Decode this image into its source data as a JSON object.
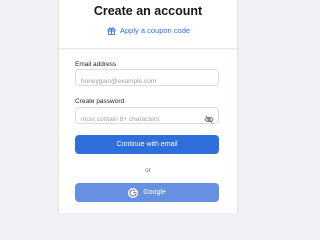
{
  "header": {
    "title": "Create an account",
    "coupon_label": "Apply a coupon code"
  },
  "form": {
    "email": {
      "label": "Email address",
      "value": "",
      "placeholder": "honeygain@example.com"
    },
    "password": {
      "label": "Create password",
      "value": "",
      "placeholder": "must contain 8+ characters"
    },
    "continue_label": "Continue with email",
    "divider_text": "or",
    "google_label": "Google"
  },
  "icons": {
    "coupon": "gift-icon",
    "password_toggle": "eye-off-icon",
    "google": "google-logo-icon"
  },
  "colors": {
    "accent": "#2f6fdc",
    "google_button": "#6790e3",
    "background": "#f0f1f4"
  }
}
